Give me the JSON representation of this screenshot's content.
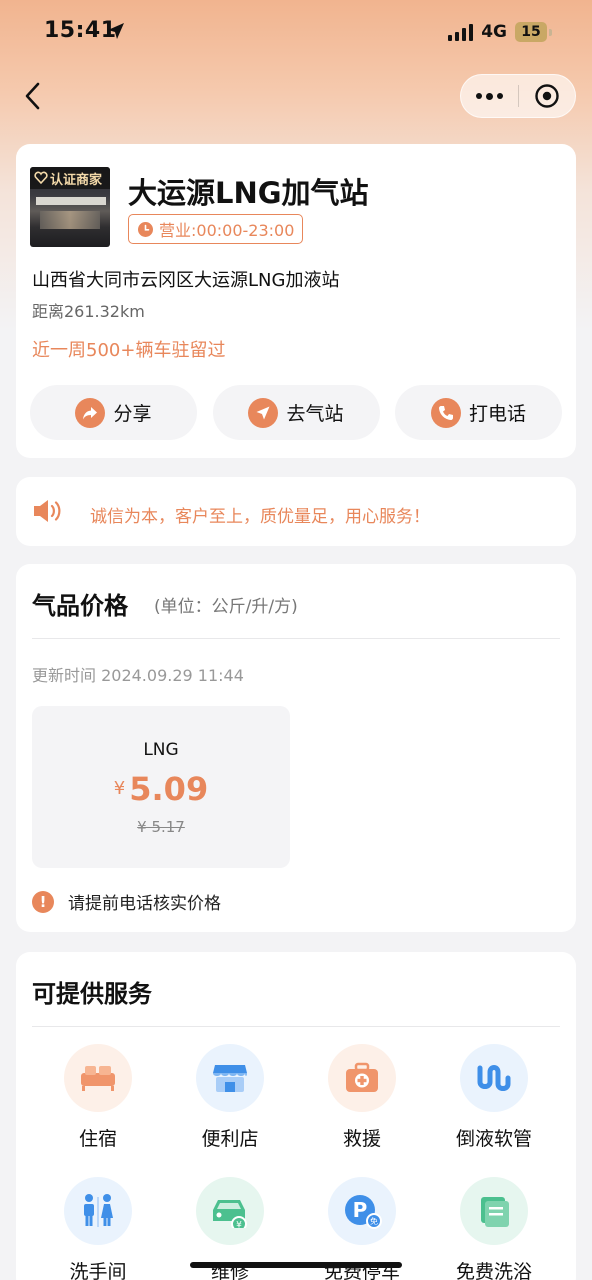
{
  "status_bar": {
    "time": "15:41",
    "network": "4G",
    "battery": "15"
  },
  "station": {
    "badge": "认证商家",
    "name": "大运源LNG加气站",
    "hours": "营业:00:00-23:00",
    "address": "山西省大同市云冈区大运源LNG加液站",
    "distance": "距离261.32km",
    "popularity": "近一周500+辆车驻留过",
    "actions": [
      {
        "label": "分享",
        "icon": "share-icon"
      },
      {
        "label": "去气站",
        "icon": "navigate-icon"
      },
      {
        "label": "打电话",
        "icon": "phone-icon"
      }
    ]
  },
  "notice": {
    "text": "诚信为本，客户至上，质优量足，用心服务！",
    "icon": "speaker-icon"
  },
  "prices": {
    "title": "气品价格",
    "unit": "(单位：公斤/升/方)",
    "update_time": "更新时间 2024.09.29 11:44",
    "items": [
      {
        "name": "LNG",
        "currency": "¥",
        "price": "5.09",
        "old_price": "¥ 5.17"
      }
    ],
    "warning": "请提前电话核实价格"
  },
  "services": {
    "title": "可提供服务",
    "items": [
      {
        "label": "住宿",
        "icon": "bed-icon",
        "bg": "#fdf0e8"
      },
      {
        "label": "便利店",
        "icon": "store-icon",
        "bg": "#eaf3fd"
      },
      {
        "label": "救援",
        "icon": "first-aid-icon",
        "bg": "#fdf0e8"
      },
      {
        "label": "倒液软管",
        "icon": "hose-icon",
        "bg": "#eaf3fd"
      },
      {
        "label": "洗手间",
        "icon": "restroom-icon",
        "bg": "#eaf3fd"
      },
      {
        "label": "维修",
        "icon": "car-repair-icon",
        "bg": "#e6f6ef"
      },
      {
        "label": "免费停车",
        "icon": "parking-icon",
        "bg": "#eaf3fd"
      },
      {
        "label": "免费洗浴",
        "icon": "towel-icon",
        "bg": "#e6f6ef"
      }
    ]
  },
  "colors": {
    "accent": "#e8875b",
    "blue": "#3f8fe8",
    "green": "#4cc08f"
  }
}
